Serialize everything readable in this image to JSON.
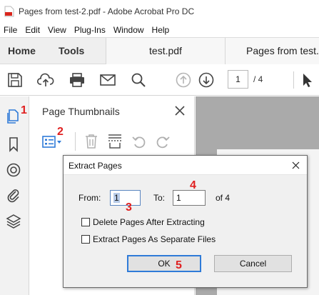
{
  "window": {
    "title": "Pages from test-2.pdf - Adobe Acrobat Pro DC"
  },
  "menu": [
    "File",
    "Edit",
    "View",
    "Plug-Ins",
    "Window",
    "Help"
  ],
  "tabs": {
    "home": "Home",
    "tools": "Tools",
    "documents": [
      "test.pdf",
      "Pages from test.p"
    ]
  },
  "toolbar": {
    "current_page": "1",
    "page_total": "/ 4"
  },
  "panel": {
    "title": "Page Thumbnails"
  },
  "annotations": [
    "1",
    "2",
    "3",
    "4",
    "5"
  ],
  "dialog": {
    "title": "Extract Pages",
    "from_label": "From:",
    "from_value": "1",
    "to_label": "To:",
    "to_value": "1",
    "of_text": "of 4",
    "option_delete": "Delete Pages After Extracting",
    "option_separate": "Extract Pages As Separate Files",
    "ok_label": "OK",
    "cancel_label": "Cancel"
  },
  "colors": {
    "accent_blue": "#2f7bd8",
    "annotation_red": "#e02020",
    "acrobat_red": "#d9261c"
  }
}
